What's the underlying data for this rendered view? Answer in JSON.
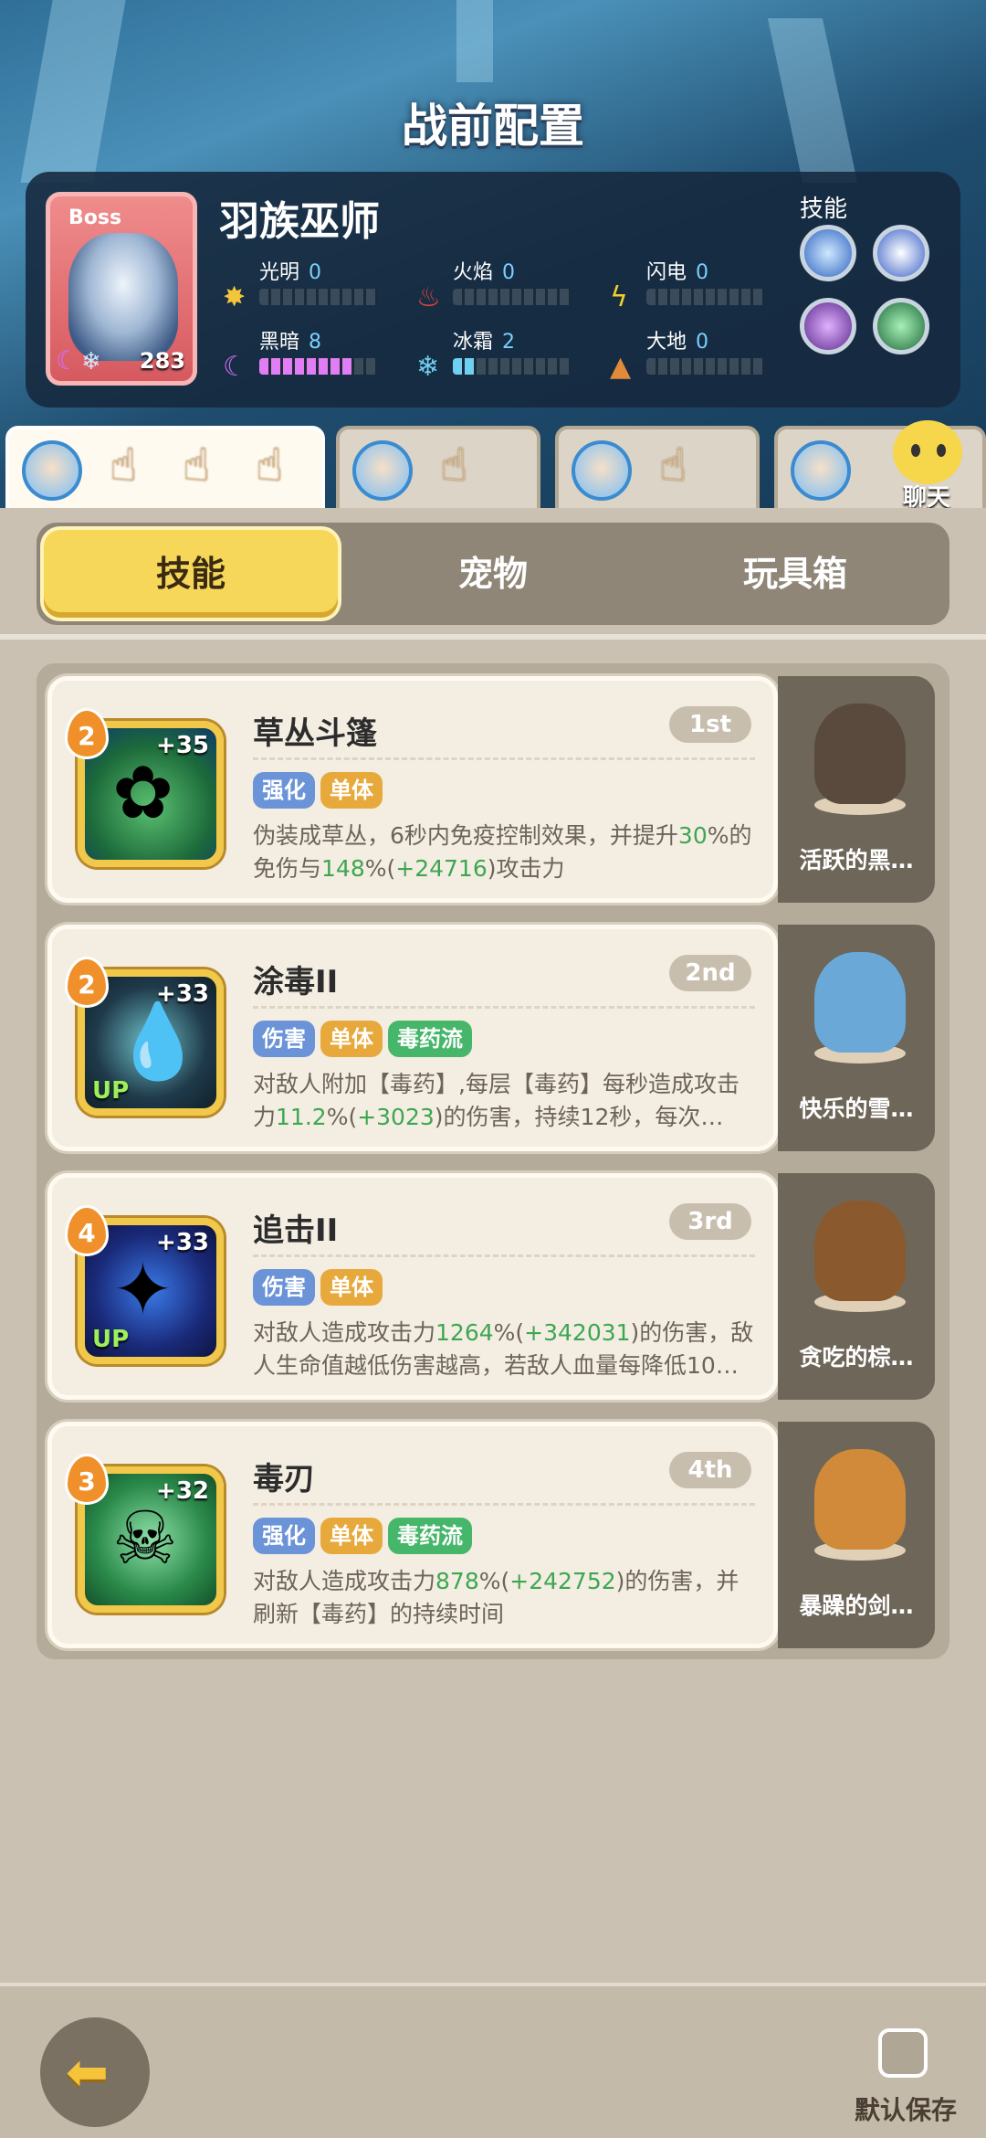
{
  "page_title": "战前配置",
  "boss": {
    "tag": "Boss",
    "name": "羽族巫师",
    "level": "283",
    "skills_title": "技能"
  },
  "elements": [
    {
      "name": "光明",
      "value": "0",
      "icon": "sun-icon",
      "color": "#f2c53a",
      "fill": 0.0
    },
    {
      "name": "火焰",
      "value": "0",
      "icon": "flame-icon",
      "color": "#e0483a",
      "fill": 0.0
    },
    {
      "name": "闪电",
      "value": "0",
      "icon": "lightning-icon",
      "color": "#f5d02a",
      "fill": 0.0
    },
    {
      "name": "黑暗",
      "value": "8",
      "icon": "moon-icon",
      "color": "#e27ef5",
      "fill": 0.8
    },
    {
      "name": "冰霜",
      "value": "2",
      "icon": "snowflake-icon",
      "color": "#6fd0f2",
      "fill": 0.2
    },
    {
      "name": "大地",
      "value": "0",
      "icon": "mountain-icon",
      "color": "#e08a3a",
      "fill": 0.0
    }
  ],
  "chat_label": "聊天",
  "tabs": {
    "skill": "技能",
    "pet": "宠物",
    "toybox": "玩具箱"
  },
  "skills": [
    {
      "level": "2",
      "plus": "+35",
      "up": "",
      "name": "草丛斗篷",
      "rank": "1st",
      "tags": [
        {
          "text": "强化",
          "style": "blue"
        },
        {
          "text": "单体",
          "style": "gold"
        }
      ],
      "desc": [
        {
          "t": "伪装成草丛，6秒内免疫控制效果，并提升",
          "g": false
        },
        {
          "t": "30",
          "g": true
        },
        {
          "t": "%的免伤与",
          "g": false
        },
        {
          "t": "148",
          "g": true
        },
        {
          "t": "%(",
          "g": false
        },
        {
          "t": "+24716",
          "g": true
        },
        {
          "t": ")攻击力",
          "g": false
        }
      ],
      "pet_name": "活跃的黑…"
    },
    {
      "level": "2",
      "plus": "+33",
      "up": "UP",
      "name": "涂毒II",
      "rank": "2nd",
      "tags": [
        {
          "text": "伤害",
          "style": "blue"
        },
        {
          "text": "单体",
          "style": "gold"
        },
        {
          "text": "毒药流",
          "style": "green"
        }
      ],
      "desc": [
        {
          "t": "对敌人附加【毒药】,每层【毒药】每秒造成攻击力",
          "g": false
        },
        {
          "t": "11.2",
          "g": true
        },
        {
          "t": "%(",
          "g": false
        },
        {
          "t": "+3023",
          "g": true
        },
        {
          "t": ")的伤害，持续12秒，每次…",
          "g": false
        }
      ],
      "pet_name": "快乐的雪…"
    },
    {
      "level": "4",
      "plus": "+33",
      "up": "UP",
      "name": "追击II",
      "rank": "3rd",
      "tags": [
        {
          "text": "伤害",
          "style": "blue"
        },
        {
          "text": "单体",
          "style": "gold"
        }
      ],
      "desc": [
        {
          "t": "对敌人造成攻击力",
          "g": false
        },
        {
          "t": "1264",
          "g": true
        },
        {
          "t": "%(",
          "g": false
        },
        {
          "t": "+342031",
          "g": true
        },
        {
          "t": ")的伤害，敌人生命值越低伤害越高，若敌人血量每降低10…",
          "g": false
        }
      ],
      "pet_name": "贪吃的棕…"
    },
    {
      "level": "3",
      "plus": "+32",
      "up": "",
      "name": "毒刃",
      "rank": "4th",
      "tags": [
        {
          "text": "强化",
          "style": "blue"
        },
        {
          "text": "单体",
          "style": "gold"
        },
        {
          "text": "毒药流",
          "style": "green"
        }
      ],
      "desc": [
        {
          "t": "对敌人造成攻击力",
          "g": false
        },
        {
          "t": "878",
          "g": true
        },
        {
          "t": "%(",
          "g": false
        },
        {
          "t": "+242752",
          "g": true
        },
        {
          "t": ")的伤害，并刷新【毒药】的持续时间",
          "g": false
        }
      ],
      "pet_name": "暴躁的剑…"
    }
  ],
  "bottom": {
    "save_label": "默认保存"
  }
}
